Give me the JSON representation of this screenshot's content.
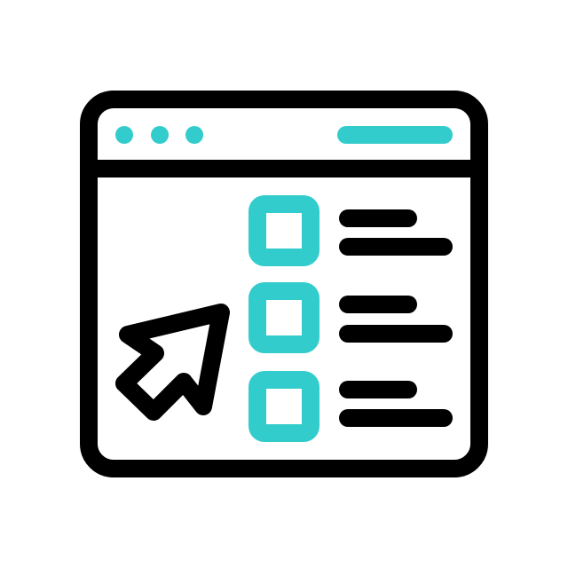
{
  "icon": {
    "name": "browser-checklist-cursor-icon",
    "colors": {
      "outline": "#000000",
      "accent": "#33cccc",
      "background": "#ffffff"
    },
    "window_dots": 3,
    "checkbox_rows": 3
  }
}
